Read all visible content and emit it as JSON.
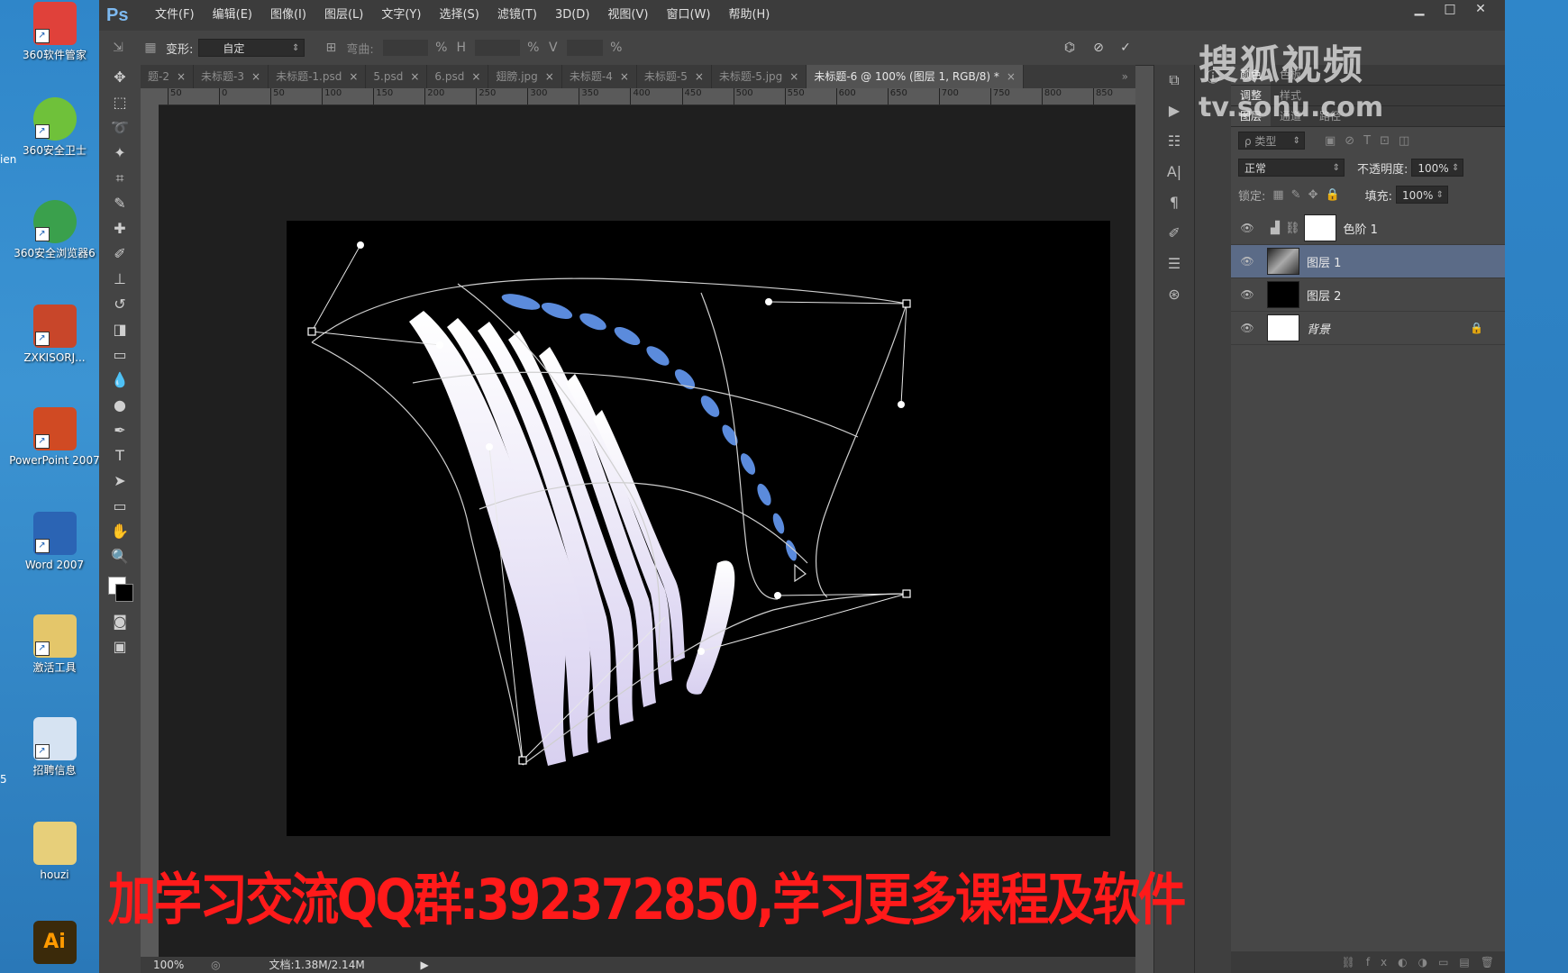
{
  "desktop": {
    "icons": [
      {
        "label": "360软件管家",
        "color": "#e0413a"
      },
      {
        "label": "360安全卫士",
        "color": "#6fc13a"
      },
      {
        "label": "360安全浏览器6",
        "color": "#3aa04c"
      },
      {
        "label": "ZXKISORJ...",
        "color": "#c8462a"
      },
      {
        "label": "PowerPoint 2007",
        "color": "#d04a23"
      },
      {
        "label": "Word 2007",
        "color": "#2b64b4"
      },
      {
        "label": "激活工具",
        "color": "#e4c66a"
      },
      {
        "label": "招聘信息",
        "color": "#d6e3f2"
      },
      {
        "label": "houzi",
        "color": "#e7cf7a"
      },
      {
        "label": "Ai",
        "color": "#3b2a0a"
      }
    ],
    "edge_labels": [
      "ien",
      "5"
    ]
  },
  "menubar": {
    "logo": "Ps",
    "items": [
      "文件(F)",
      "编辑(E)",
      "图像(I)",
      "图层(L)",
      "文字(Y)",
      "选择(S)",
      "滤镜(T)",
      "3D(D)",
      "视图(V)",
      "窗口(W)",
      "帮助(H)"
    ],
    "window_buttons": [
      "▁",
      "□",
      "✕"
    ]
  },
  "options": {
    "warp_label": "变形:",
    "warp_value": "自定",
    "bend_label": "弯曲:",
    "confirm_icon": "✓",
    "cancel_icon": "⊘"
  },
  "tabs": [
    {
      "label": "题-2",
      "active": false
    },
    {
      "label": "未标题-3",
      "active": false
    },
    {
      "label": "未标题-1.psd",
      "active": false
    },
    {
      "label": "5.psd",
      "active": false
    },
    {
      "label": "6.psd",
      "active": false
    },
    {
      "label": "翅膀.jpg",
      "active": false
    },
    {
      "label": "未标题-4",
      "active": false
    },
    {
      "label": "未标题-5",
      "active": false
    },
    {
      "label": "未标题-5.jpg",
      "active": false
    },
    {
      "label": "未标题-6 @ 100% (图层 1, RGB/8) *",
      "active": true
    }
  ],
  "ruler": {
    "ticks": [
      "50",
      "0",
      "50",
      "100",
      "150",
      "200",
      "250",
      "300",
      "350",
      "400",
      "450",
      "500",
      "550",
      "600",
      "650",
      "700",
      "750",
      "800",
      "850"
    ]
  },
  "status": {
    "zoom": "100%",
    "doc": "文档:1.38M/2.14M"
  },
  "panels": {
    "top_tabs": [
      "颜色",
      "色板"
    ],
    "mid_tabs": [
      "调整",
      "样式"
    ],
    "layer_tabs": [
      "图层",
      "通道",
      "路径"
    ],
    "filter_label": "ρ 类型",
    "blend_mode": "正常",
    "opacity_label": "不透明度:",
    "opacity_value": "100%",
    "lock_label": "锁定:",
    "fill_label": "填充:",
    "fill_value": "100%",
    "layers": [
      {
        "name": "色阶 1",
        "thumb": "#ffffff",
        "active": false
      },
      {
        "name": "图层 1",
        "thumb": "#777777",
        "active": true
      },
      {
        "name": "图层 2",
        "thumb": "#000000",
        "active": false
      },
      {
        "name": "背景",
        "thumb": "#ffffff",
        "active": false
      }
    ]
  },
  "watermark": {
    "line1": "搜狐视频",
    "line2": "tv.sohu.com"
  },
  "promo_text": "加学习交流QQ群:392372850,学习更多课程及软件"
}
